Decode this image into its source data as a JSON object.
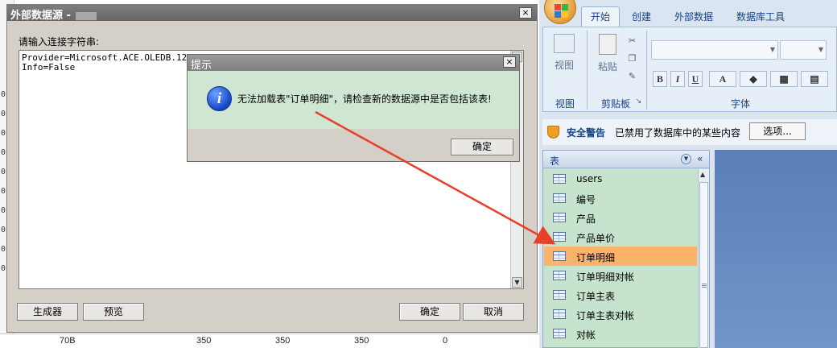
{
  "background": {
    "left_strip": [
      "0",
      "0",
      "0",
      "0",
      "0",
      "0",
      "0",
      "0",
      "0",
      "0"
    ],
    "bottom_row": [
      "70B",
      "350",
      "350",
      "350",
      "0"
    ]
  },
  "ext_dialog": {
    "title": "外部数据源 - ",
    "label": "请输入连接字符串:",
    "connection_string": "Provider=Microsoft.ACE.OLEDB.12.0;Data Source=...;Extended Properties=...;Persist Security\nInfo=False",
    "close": "×",
    "buttons": {
      "generate": "生成器",
      "preview": "预览",
      "ok": "确定",
      "cancel": "取消"
    }
  },
  "message_box": {
    "title": "提示",
    "text": "无法加载表\"订单明细\"，请检查新的数据源中是否包括该表!",
    "ok": "确定",
    "close": "×",
    "icon": "info-icon"
  },
  "access": {
    "tabs": [
      "开始",
      "创建",
      "外部数据",
      "数据库工具"
    ],
    "groups": {
      "view": "视图",
      "clipboard": "剪贴板",
      "font": "字体"
    },
    "view_btn": "视图",
    "paste_btn": "粘贴",
    "format_buttons": [
      "B",
      "I",
      "U",
      "A"
    ],
    "security": {
      "title": "安全警告",
      "message": "已禁用了数据库中的某些内容",
      "options_btn": "选项..."
    },
    "nav": {
      "header": "表",
      "items": [
        {
          "label": "users",
          "selected": false
        },
        {
          "label": "编号",
          "selected": false
        },
        {
          "label": "产品",
          "selected": false
        },
        {
          "label": "产品单价",
          "selected": false
        },
        {
          "label": "订单明细",
          "selected": true
        },
        {
          "label": "订单明细对帐",
          "selected": false
        },
        {
          "label": "订单主表",
          "selected": false
        },
        {
          "label": "订单主表对帐",
          "selected": false
        },
        {
          "label": "对帐",
          "selected": false
        }
      ]
    }
  },
  "colors": {
    "selected_item": "#fbb36b",
    "nav_bg": "#c6e3cd",
    "annotation_arrow": "#e8402a"
  }
}
